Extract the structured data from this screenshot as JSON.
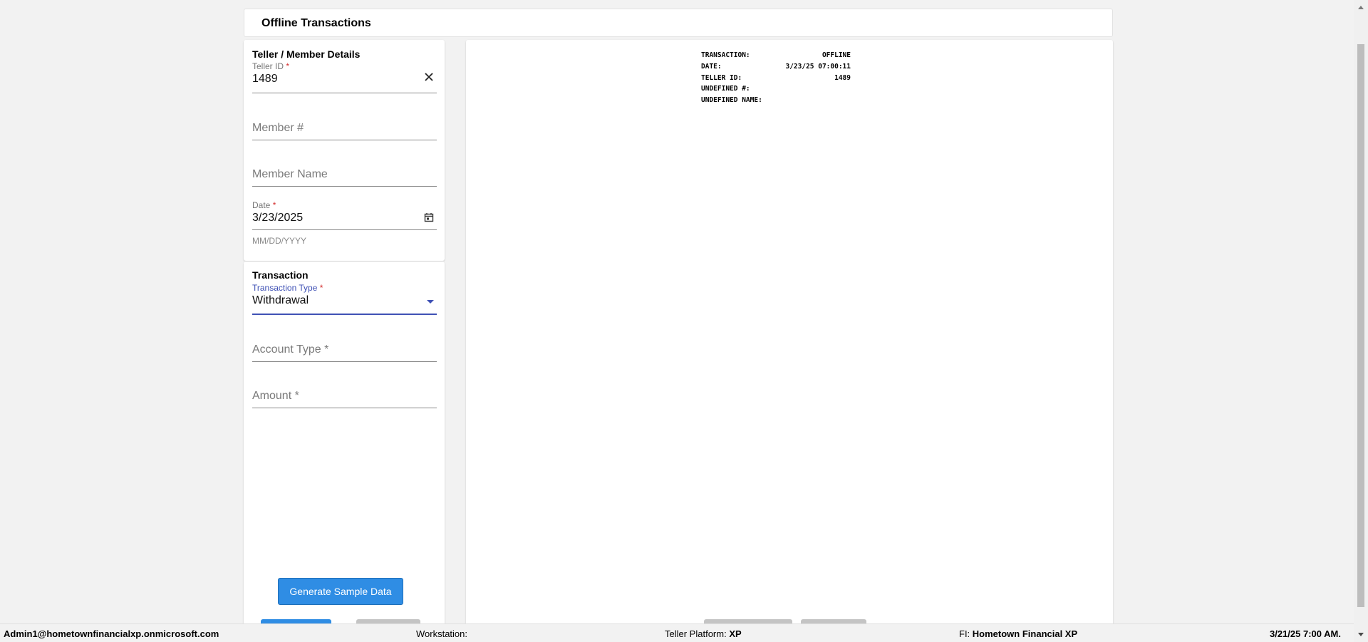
{
  "page": {
    "title": "Offline Transactions"
  },
  "details": {
    "section_title": "Teller / Member Details",
    "teller_id": {
      "label": "Teller ID",
      "required_mark": "*",
      "value": "1489",
      "clear_icon": "close-icon"
    },
    "member_number": {
      "placeholder": "Member #"
    },
    "member_name": {
      "placeholder": "Member Name"
    },
    "date": {
      "label": "Date",
      "required_mark": "*",
      "value": "3/23/2025",
      "hint": "MM/DD/YYYY",
      "icon": "calendar-icon"
    }
  },
  "transaction": {
    "section_title": "Transaction",
    "type": {
      "label": "Transaction Type",
      "required_mark": "*",
      "value": "Withdrawal",
      "icon": "dropdown-caret-icon"
    },
    "account_type": {
      "placeholder": "Account Type *"
    },
    "amount": {
      "placeholder": "Amount *"
    },
    "generate_button": "Generate Sample Data"
  },
  "receipt": {
    "rows": [
      {
        "label": "TRANSACTION:",
        "value": "OFFLINE"
      },
      {
        "label": "DATE:",
        "value": "3/23/25 07:00:11"
      },
      {
        "label": "TELLER ID:",
        "value": "1489"
      },
      {
        "label": "UNDEFINED #:",
        "value": ""
      },
      {
        "label": "UNDEFINED NAME:",
        "value": ""
      }
    ]
  },
  "status_bar": {
    "user": "Admin1@hometownfinancialxp.onmicrosoft.com",
    "workstation_label": "Workstation:",
    "workstation_value": "",
    "platform_label": "Teller Platform:",
    "platform_value": "XP",
    "fi_label": "FI:",
    "fi_value": "Hometown Financial XP",
    "datetime": "3/21/25 7:00 AM."
  },
  "colors": {
    "primary_button": "#2f8de4",
    "focus_accent": "#3f51b5",
    "required_mark": "#d32f2f",
    "page_background": "#f2f2f2"
  }
}
